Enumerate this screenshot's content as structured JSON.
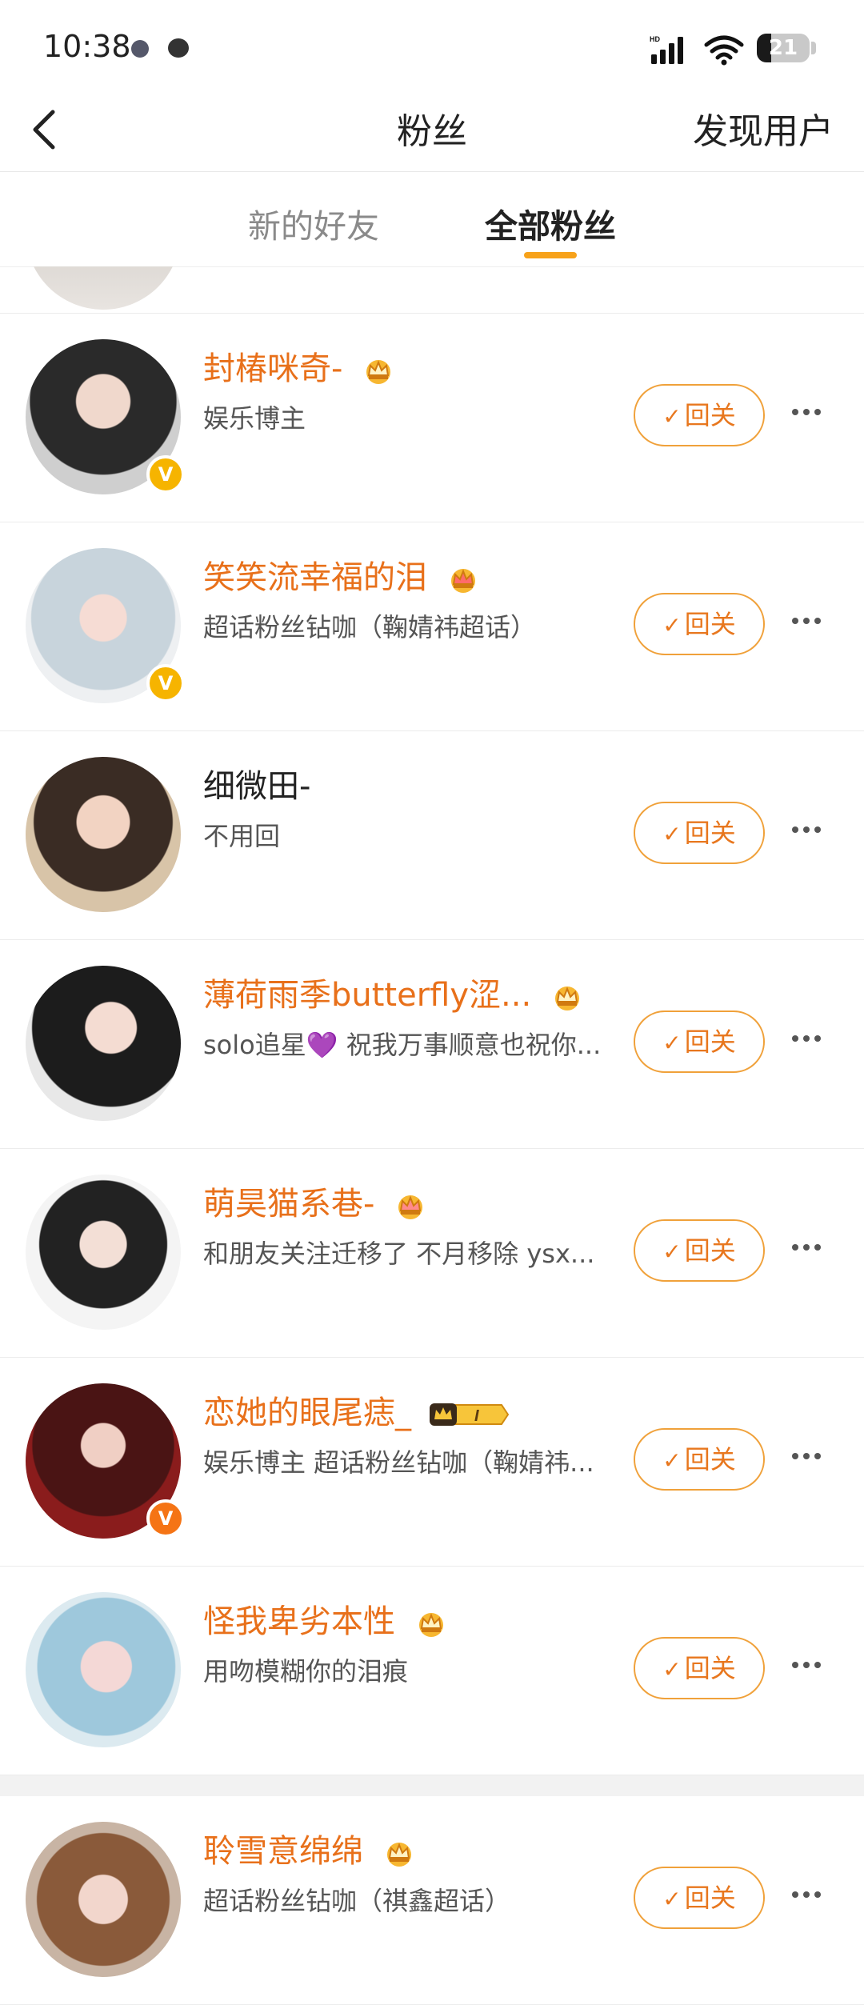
{
  "status_bar": {
    "time": "10:38",
    "battery": "21",
    "network_label": "HD"
  },
  "nav": {
    "title": "粉丝",
    "right_action": "发现用户"
  },
  "tabs": [
    {
      "label": "新的好友",
      "active": false
    },
    {
      "label": "全部粉丝",
      "active": true
    }
  ],
  "accent_color": "#f7a21a",
  "name_color": "#e8701a",
  "fans": [
    {
      "name": "封椿咪奇-",
      "badge": "crown-icon",
      "desc": "娱乐博主",
      "verified": "yellow-v",
      "button": "回关"
    },
    {
      "name": "笑笑流幸福的泪",
      "badge": "crown-icon",
      "desc": "超话粉丝钻咖（鞠婧祎超话）",
      "verified": "yellow-v",
      "button": "回关"
    },
    {
      "name": "细微田-",
      "badge": "",
      "desc": "不用回",
      "verified": "",
      "button": "回关"
    },
    {
      "name": "薄荷雨季butterfly涩...",
      "badge": "crown-icon",
      "desc": "solo追星💜 祝我万事顺意也祝你...",
      "verified": "",
      "button": "回关"
    },
    {
      "name": "萌昊猫系巷-",
      "badge": "crown-icon",
      "desc": "和朋友关注迁移了 不月移除 ysx...",
      "verified": "",
      "button": "回关"
    },
    {
      "name": "恋她的眼尾痣_",
      "badge": "vip-crown-badge",
      "vip_level": "I",
      "desc": "娱乐博主 超话粉丝钻咖（鞠婧祎...",
      "verified": "orange-v",
      "button": "回关"
    },
    {
      "name": "怪我卑劣本性",
      "badge": "crown-icon",
      "desc": "用吻模糊你的泪痕",
      "verified": "",
      "button": "回关"
    },
    {
      "name": "聆雪意绵绵",
      "badge": "crown-icon",
      "desc": "超话粉丝钻咖（祺鑫超话）",
      "verified": "",
      "button": "回关"
    }
  ]
}
